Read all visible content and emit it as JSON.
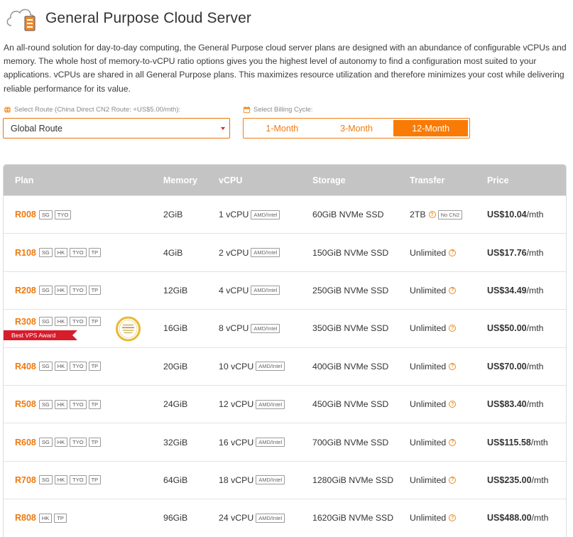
{
  "header": {
    "title": "General Purpose Cloud Server"
  },
  "intro": "An all-round solution for day-to-day computing, the General Purpose cloud server plans are designed with an abundance of configurable vCPUs and memory. The whole host of memory-to-vCPU ratio options gives you the highest level of autonomy to find a configuration most suited to your applications. vCPUs are shared in all General Purpose plans. This maximizes resource utilization and therefore minimizes your cost while delivering reliable performance for its value.",
  "route": {
    "label": "Select Route (China Direct CN2 Route: +US$5.00/mth):",
    "selected": "Global Route"
  },
  "billing": {
    "label": "Select Billing Cycle:",
    "options": [
      "1-Month",
      "3-Month",
      "12-Month"
    ],
    "selected": "12-Month"
  },
  "colors": {
    "accent": "#f97b05",
    "award": "#d71c2b",
    "header_bg": "#c4c4c4"
  },
  "table": {
    "headers": [
      "Plan",
      "Memory",
      "vCPU",
      "Storage",
      "Transfer",
      "Price"
    ],
    "cpu_tag": "AMD/Intel",
    "price_unit": "/mth",
    "award_label": "Best VPS Award",
    "rows": [
      {
        "plan": "R008",
        "tags": [
          "SG",
          "TYO"
        ],
        "memory": "2GiB",
        "vcpu": "1 vCPU",
        "storage": "60GiB NVMe SSD",
        "transfer": "2TB",
        "transfer_note": "No CN2",
        "price": "US$10.04"
      },
      {
        "plan": "R108",
        "tags": [
          "SG",
          "HK",
          "TYO",
          "TP"
        ],
        "memory": "4GiB",
        "vcpu": "2 vCPU",
        "storage": "150GiB NVMe SSD",
        "transfer": "Unlimited",
        "price": "US$17.76"
      },
      {
        "plan": "R208",
        "tags": [
          "SG",
          "HK",
          "TYO",
          "TP"
        ],
        "memory": "12GiB",
        "vcpu": "4 vCPU",
        "storage": "250GiB NVMe SSD",
        "transfer": "Unlimited",
        "price": "US$34.49"
      },
      {
        "plan": "R308",
        "tags": [
          "SG",
          "HK",
          "TYO",
          "TP"
        ],
        "memory": "16GiB",
        "vcpu": "8 vCPU",
        "storage": "350GiB NVMe SSD",
        "transfer": "Unlimited",
        "price": "US$50.00",
        "award": true
      },
      {
        "plan": "R408",
        "tags": [
          "SG",
          "HK",
          "TYO",
          "TP"
        ],
        "memory": "20GiB",
        "vcpu": "10 vCPU",
        "storage": "400GiB NVMe SSD",
        "transfer": "Unlimited",
        "price": "US$70.00"
      },
      {
        "plan": "R508",
        "tags": [
          "SG",
          "HK",
          "TYO",
          "TP"
        ],
        "memory": "24GiB",
        "vcpu": "12 vCPU",
        "storage": "450GiB NVMe SSD",
        "transfer": "Unlimited",
        "price": "US$83.40"
      },
      {
        "plan": "R608",
        "tags": [
          "SG",
          "HK",
          "TYO",
          "TP"
        ],
        "memory": "32GiB",
        "vcpu": "16 vCPU",
        "storage": "700GiB NVMe SSD",
        "transfer": "Unlimited",
        "price": "US$115.58"
      },
      {
        "plan": "R708",
        "tags": [
          "SG",
          "HK",
          "TYO",
          "TP"
        ],
        "memory": "64GiB",
        "vcpu": "18 vCPU",
        "storage": "1280GiB NVMe SSD",
        "transfer": "Unlimited",
        "price": "US$235.00"
      },
      {
        "plan": "R808",
        "tags": [
          "HK",
          "TP"
        ],
        "memory": "96GiB",
        "vcpu": "24 vCPU",
        "storage": "1620GiB NVMe SSD",
        "transfer": "Unlimited",
        "price": "US$488.00"
      }
    ]
  }
}
